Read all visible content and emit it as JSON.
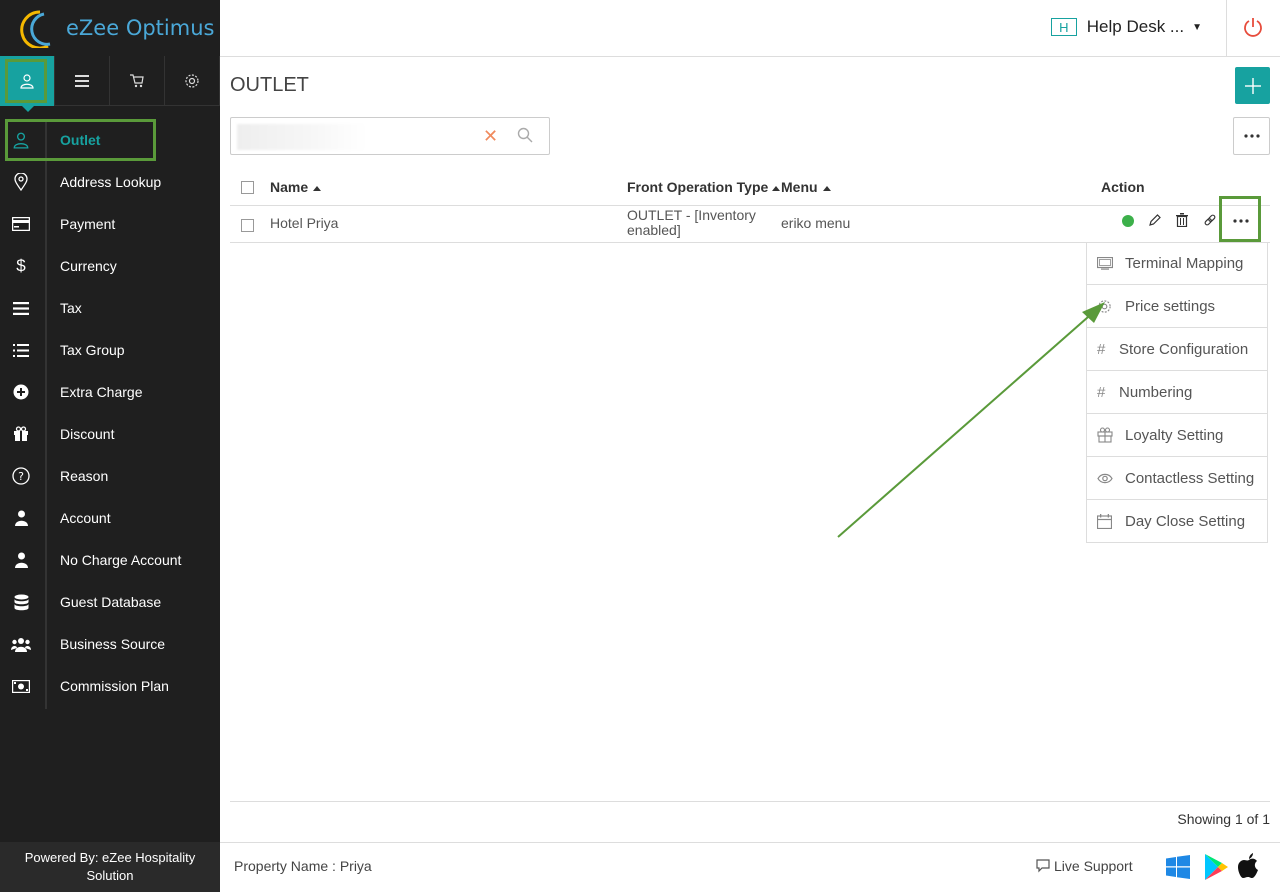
{
  "brand": {
    "name": "eZee Optimus"
  },
  "header": {
    "property_badge": "H",
    "property_name": "Help Desk ..."
  },
  "sidebar": {
    "items": [
      {
        "label": "Outlet",
        "icon": "user-icon",
        "active": true
      },
      {
        "label": "Address Lookup",
        "icon": "map-pin-icon"
      },
      {
        "label": "Payment",
        "icon": "credit-card-icon"
      },
      {
        "label": "Currency",
        "icon": "dollar-icon"
      },
      {
        "label": "Tax",
        "icon": "menu-bars-icon"
      },
      {
        "label": "Tax Group",
        "icon": "list-icon"
      },
      {
        "label": "Extra Charge",
        "icon": "plus-circle-icon"
      },
      {
        "label": "Discount",
        "icon": "gift-icon"
      },
      {
        "label": "Reason",
        "icon": "question-circle-icon"
      },
      {
        "label": "Account",
        "icon": "person-icon"
      },
      {
        "label": "No Charge Account",
        "icon": "person-icon"
      },
      {
        "label": "Guest Database",
        "icon": "database-icon"
      },
      {
        "label": "Business Source",
        "icon": "users-icon"
      },
      {
        "label": "Commission Plan",
        "icon": "money-icon"
      }
    ],
    "powered_by": "Powered By: eZee Hospitality Solution"
  },
  "main": {
    "title": "OUTLET",
    "search": {
      "value": "",
      "placeholder": ""
    },
    "columns": {
      "name": "Name",
      "front_op": "Front Operation Type",
      "menu": "Menu",
      "action": "Action"
    },
    "rows": [
      {
        "name": "Hotel Priya",
        "front_op": "OUTLET - [Inventory enabled]",
        "menu": "eriko menu",
        "status_color": "#3cb04a"
      }
    ],
    "dropdown": [
      {
        "label": "Terminal Mapping",
        "icon": "monitor-icon"
      },
      {
        "label": "Price settings",
        "icon": "gear-icon"
      },
      {
        "label": "Store Configuration",
        "icon": "hash-icon"
      },
      {
        "label": "Numbering",
        "icon": "hash-icon"
      },
      {
        "label": "Loyalty Setting",
        "icon": "gift-icon"
      },
      {
        "label": "Contactless Setting",
        "icon": "eye-icon"
      },
      {
        "label": "Day Close Setting",
        "icon": "calendar-icon"
      }
    ],
    "showing": "Showing 1 of 1"
  },
  "footer": {
    "property": "Property Name : Priya",
    "live_support": "Live Support"
  },
  "colors": {
    "accent": "#17a2a0",
    "highlight": "#5a9a3a",
    "sidebar_bg": "#1f1f1f"
  }
}
